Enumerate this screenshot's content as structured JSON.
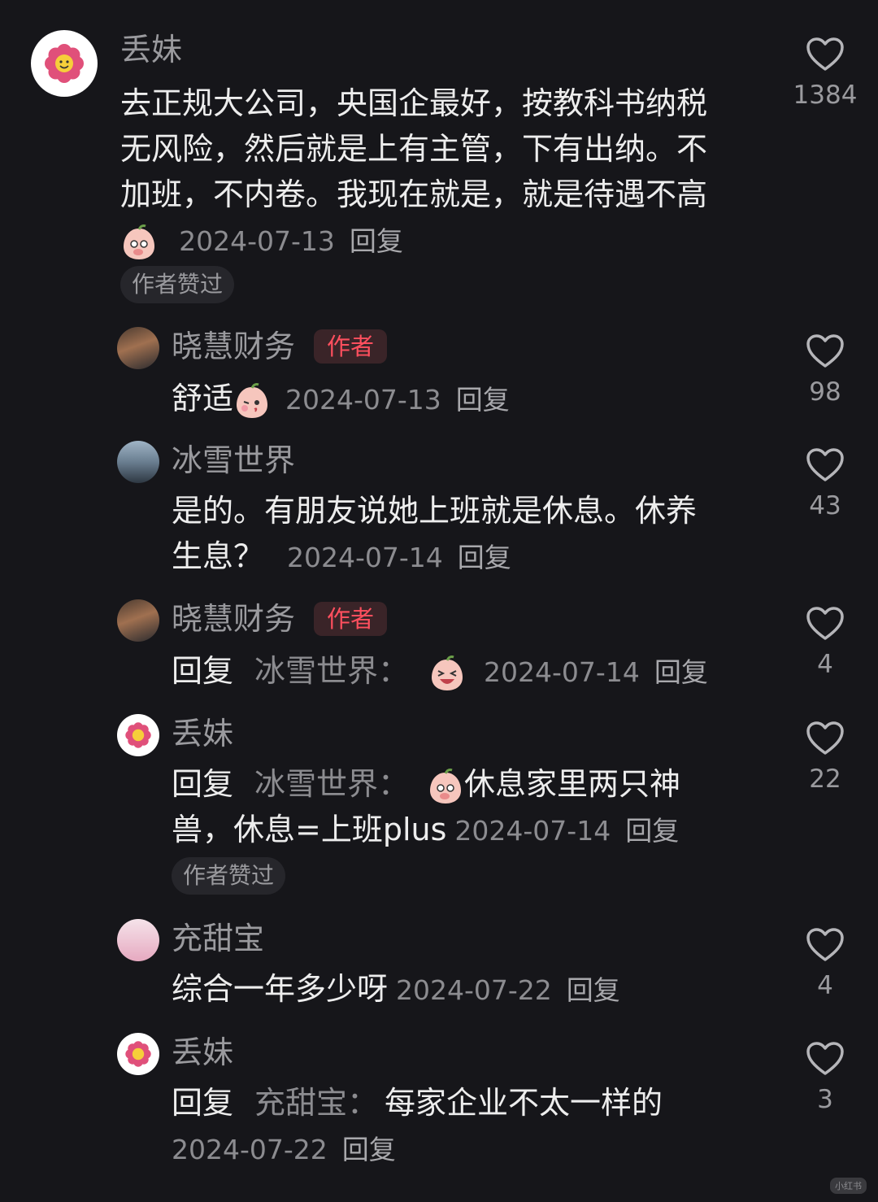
{
  "comments": [
    {
      "user": "丢妹",
      "lines": [
        "去正规大公司，央国企最好，按教科书纳税",
        "无风险，然后就是上有主管，下有出纳。不",
        "加班，不内卷。我现在就是，就是待遇不高"
      ],
      "date": "2024-07-13",
      "reply": "回复",
      "liked_chip": "作者赞过",
      "likes": "1384"
    },
    {
      "user": "晓慧财务",
      "tag": "作者",
      "text": "舒适",
      "date": "2024-07-13",
      "reply": "回复",
      "likes": "98"
    },
    {
      "user": "冰雪世界",
      "line1": "是的。有朋友说她上班就是休息。休养",
      "line2": "生息？",
      "date": "2024-07-14",
      "reply": "回复",
      "likes": "43"
    },
    {
      "user": "晓慧财务",
      "tag": "作者",
      "prefix": "回复",
      "target": "冰雪世界：",
      "date": "2024-07-14",
      "reply": "回复",
      "likes": "4"
    },
    {
      "user": "丢妹",
      "prefix": "回复",
      "target": "冰雪世界：",
      "text1": "休息家里两只神",
      "text2": "兽，休息=上班plus",
      "date": "2024-07-14",
      "reply": "回复",
      "liked_chip": "作者赞过",
      "likes": "22"
    },
    {
      "user": "充甜宝",
      "text": "综合一年多少呀",
      "date": "2024-07-22",
      "reply": "回复",
      "likes": "4"
    },
    {
      "user": "丢妹",
      "prefix": "回复",
      "target": "充甜宝：",
      "text": "每家企业不太一样的",
      "date": "2024-07-22",
      "reply": "回复",
      "likes": "3"
    }
  ],
  "watermark": "小红书",
  "colors": {
    "background": "#16161a",
    "author_tag": "#ff4f5e",
    "text": "#ededed",
    "muted": "#8c8c90"
  }
}
